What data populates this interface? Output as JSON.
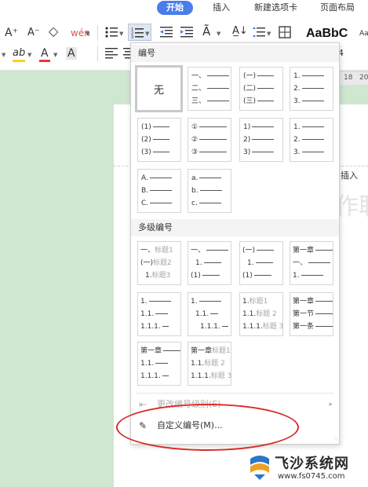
{
  "tabs": [
    {
      "label": "开始",
      "active": true
    },
    {
      "label": "插入",
      "active": false
    },
    {
      "label": "新建选项卡",
      "active": false
    },
    {
      "label": "页面布局",
      "active": false
    }
  ],
  "ribbon": {
    "font_grow": "A⁺",
    "font_shrink": "A⁻",
    "clear_format": "◇",
    "phonetic": "wén",
    "highlight_text": "ab",
    "font_color_text": "A",
    "char_shade_text": "A",
    "style_preview": "AaBbC",
    "style_preview_small": "Aa",
    "style_preview_number": "4",
    "accent": "#4a7dea",
    "highlight_color": "#ffd400",
    "font_color": "#e53935"
  },
  "ruler": {
    "ticks": [
      "18",
      "20"
    ]
  },
  "document": {
    "insert_fragment": ", 插入",
    "ghost_text": "作职"
  },
  "numbering_panel": {
    "section_numbering": "编号",
    "section_multilevel": "多级编号",
    "none_label": "无",
    "single_tiles": [
      [
        "一、",
        "二、",
        "三、"
      ],
      [
        "(一)",
        "(二)",
        "(三)"
      ],
      [
        "1.",
        "2.",
        "3."
      ],
      [
        "(1)",
        "(2)",
        "(3)"
      ],
      [
        "①",
        "②",
        "③"
      ],
      [
        "1)",
        "2)",
        "3)"
      ],
      [
        "1.",
        "2.",
        "3."
      ],
      [
        "A.",
        "B.",
        "C."
      ],
      [
        "a.",
        "b.",
        "c."
      ]
    ],
    "multi_tiles": [
      [
        {
          "p": "一、",
          "g": "标题1",
          "i": 0
        },
        {
          "p": "(一)",
          "g": "标题2",
          "i": 0
        },
        {
          "p": "1.",
          "g": "标题3",
          "i": 1
        }
      ],
      [
        {
          "p": "一、",
          "g": "",
          "i": 0
        },
        {
          "p": "1.",
          "g": "",
          "i": 1
        },
        {
          "p": "(1)",
          "g": "",
          "i": 0
        }
      ],
      [
        {
          "p": "(一)",
          "g": "",
          "i": 0
        },
        {
          "p": "1.",
          "g": "",
          "i": 1
        },
        {
          "p": "(1)",
          "g": "",
          "i": 0
        }
      ],
      [
        {
          "p": "第一章",
          "g": "",
          "i": 0
        },
        {
          "p": "一、",
          "g": "",
          "i": 0
        },
        {
          "p": "1.",
          "g": "",
          "i": 0
        }
      ],
      [
        {
          "p": "1.",
          "g": "",
          "i": 0
        },
        {
          "p": "1.1.",
          "g": "",
          "i": 0
        },
        {
          "p": "1.1.1.",
          "g": "",
          "i": 0
        }
      ],
      [
        {
          "p": "1.",
          "g": "",
          "i": 0
        },
        {
          "p": "1.1.",
          "g": "",
          "i": 1
        },
        {
          "p": "1.1.1.",
          "g": "",
          "i": 2
        }
      ],
      [
        {
          "p": "1.",
          "g": "标题1",
          "i": 0
        },
        {
          "p": "1.1.",
          "g": "标题 2",
          "i": 0
        },
        {
          "p": "1.1.1.",
          "g": "标题 3",
          "i": 0
        }
      ],
      [
        {
          "p": "第一章",
          "g": "",
          "i": 0
        },
        {
          "p": "第一节",
          "g": "",
          "i": 0
        },
        {
          "p": "第一条",
          "g": "",
          "i": 0
        }
      ],
      [
        {
          "p": "第一章",
          "g": "",
          "i": 0
        },
        {
          "p": "1.1.",
          "g": "",
          "i": 0
        },
        {
          "p": "1.1.1.",
          "g": "",
          "i": 0
        }
      ],
      [
        {
          "p": "第一章",
          "g": "标题1",
          "i": 0
        },
        {
          "p": "1.1.",
          "g": "标题 2",
          "i": 0
        },
        {
          "p": "1.1.1.",
          "g": "标题 3",
          "i": 0
        }
      ]
    ],
    "menu_change_level": "更改编号级别(E)",
    "menu_custom": "自定义编号(M)..."
  },
  "annotation_color": "#d92c25",
  "watermark": {
    "title": "飞沙系统网",
    "url": "www.fs0745.com"
  }
}
